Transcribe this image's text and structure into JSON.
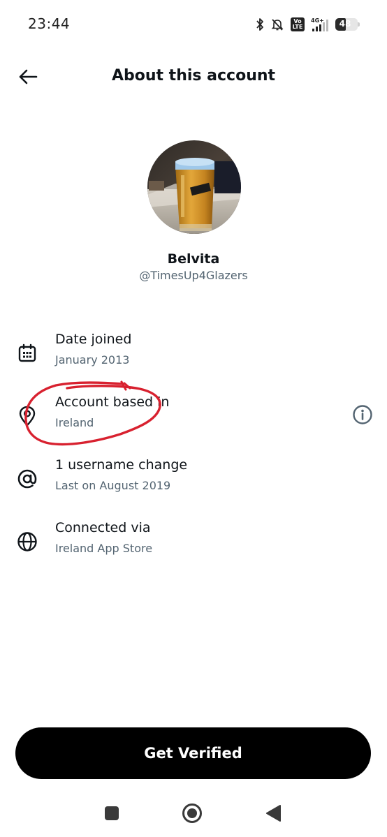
{
  "status_bar": {
    "time": "23:44",
    "network": "4G+",
    "volte": "Vo LTE",
    "battery": "48",
    "battery_level": 0.48,
    "icons": [
      "bluetooth-icon",
      "muted-bell-icon",
      "volte-icon",
      "signal-icon",
      "battery-icon"
    ]
  },
  "header": {
    "back_icon": "arrow-left-icon",
    "title": "About this account"
  },
  "profile": {
    "name": "Belvita",
    "handle": "@TimesUp4Glazers"
  },
  "rows": [
    {
      "icon": "calendar-icon",
      "title": "Date joined",
      "value": "January 2013"
    },
    {
      "icon": "location-pin-icon",
      "title": "Account based in",
      "value": "Ireland",
      "info_icon": "info-circle-icon"
    },
    {
      "icon": "at-sign-icon",
      "title": "1 username change",
      "value": "Last on August 2019"
    },
    {
      "icon": "globe-icon",
      "title": "Connected via",
      "value": "Ireland App Store"
    }
  ],
  "cta": {
    "label": "Get Verified"
  },
  "nav": {
    "icons": [
      "recents-square-icon",
      "home-circle-icon",
      "back-triangle-icon"
    ]
  },
  "colors": {
    "text_primary": "#0f1419",
    "text_secondary": "#536471",
    "annotation_red": "#d8212f",
    "cta_background": "#000000"
  }
}
